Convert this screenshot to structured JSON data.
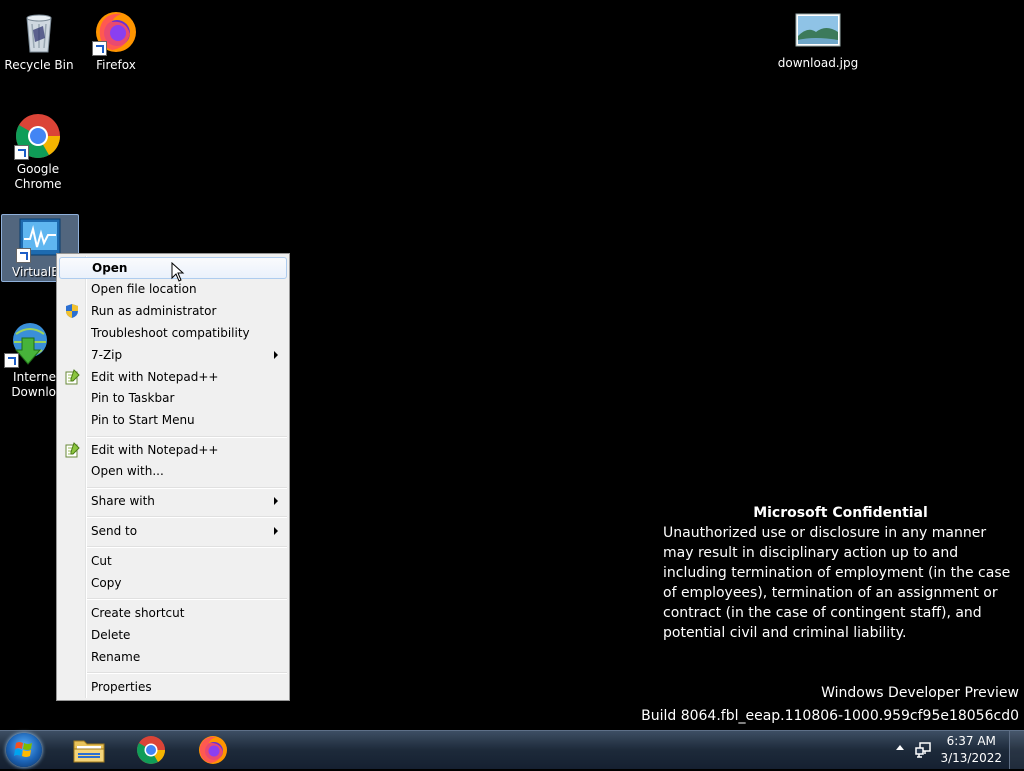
{
  "desktop_icons": [
    {
      "id": "recycle-bin",
      "label": "Recycle Bin",
      "icon": "recycle-bin-icon"
    },
    {
      "id": "firefox",
      "label": "Firefox",
      "icon": "firefox-icon"
    },
    {
      "id": "chrome",
      "label_line1": "Google",
      "label_line2": "Chrome",
      "icon": "chrome-icon"
    },
    {
      "id": "virtualbox",
      "label": "VirtualBo",
      "icon": "virtualbox-icon"
    },
    {
      "id": "idm",
      "label_line1": "Interne",
      "label_line2": "Downlo",
      "icon": "internet-download-manager-icon"
    },
    {
      "id": "download-jpg",
      "label": "download.jpg",
      "icon": "image-file-icon"
    }
  ],
  "context_menu": {
    "items": {
      "open": "Open",
      "open_file_location": "Open file location",
      "run_as_admin": "Run as administrator",
      "troubleshoot": "Troubleshoot compatibility",
      "seven_zip": "7-Zip",
      "edit_notepad_1": "Edit with Notepad++",
      "pin_taskbar": "Pin to Taskbar",
      "pin_start": "Pin to Start Menu",
      "edit_notepad_2": "Edit with Notepad++",
      "open_with": "Open with...",
      "share_with": "Share with",
      "send_to": "Send to",
      "cut": "Cut",
      "copy": "Copy",
      "create_shortcut": "Create shortcut",
      "delete": "Delete",
      "rename": "Rename",
      "properties": "Properties"
    }
  },
  "watermark": {
    "title": "Microsoft Confidential",
    "body": "Unauthorized use or disclosure in any manner may result in disciplinary action up to and including termination of employment (in the case of employees), termination of an assignment or contract (in the case of contingent staff), and potential civil and criminal liability.",
    "edition": "Windows Developer Preview",
    "build": "Build 8064.fbl_eeap.110806-1000.959cf95e18056cd0"
  },
  "taskbar": {
    "clock_time": "6:37 AM",
    "clock_date": "3/13/2022"
  }
}
